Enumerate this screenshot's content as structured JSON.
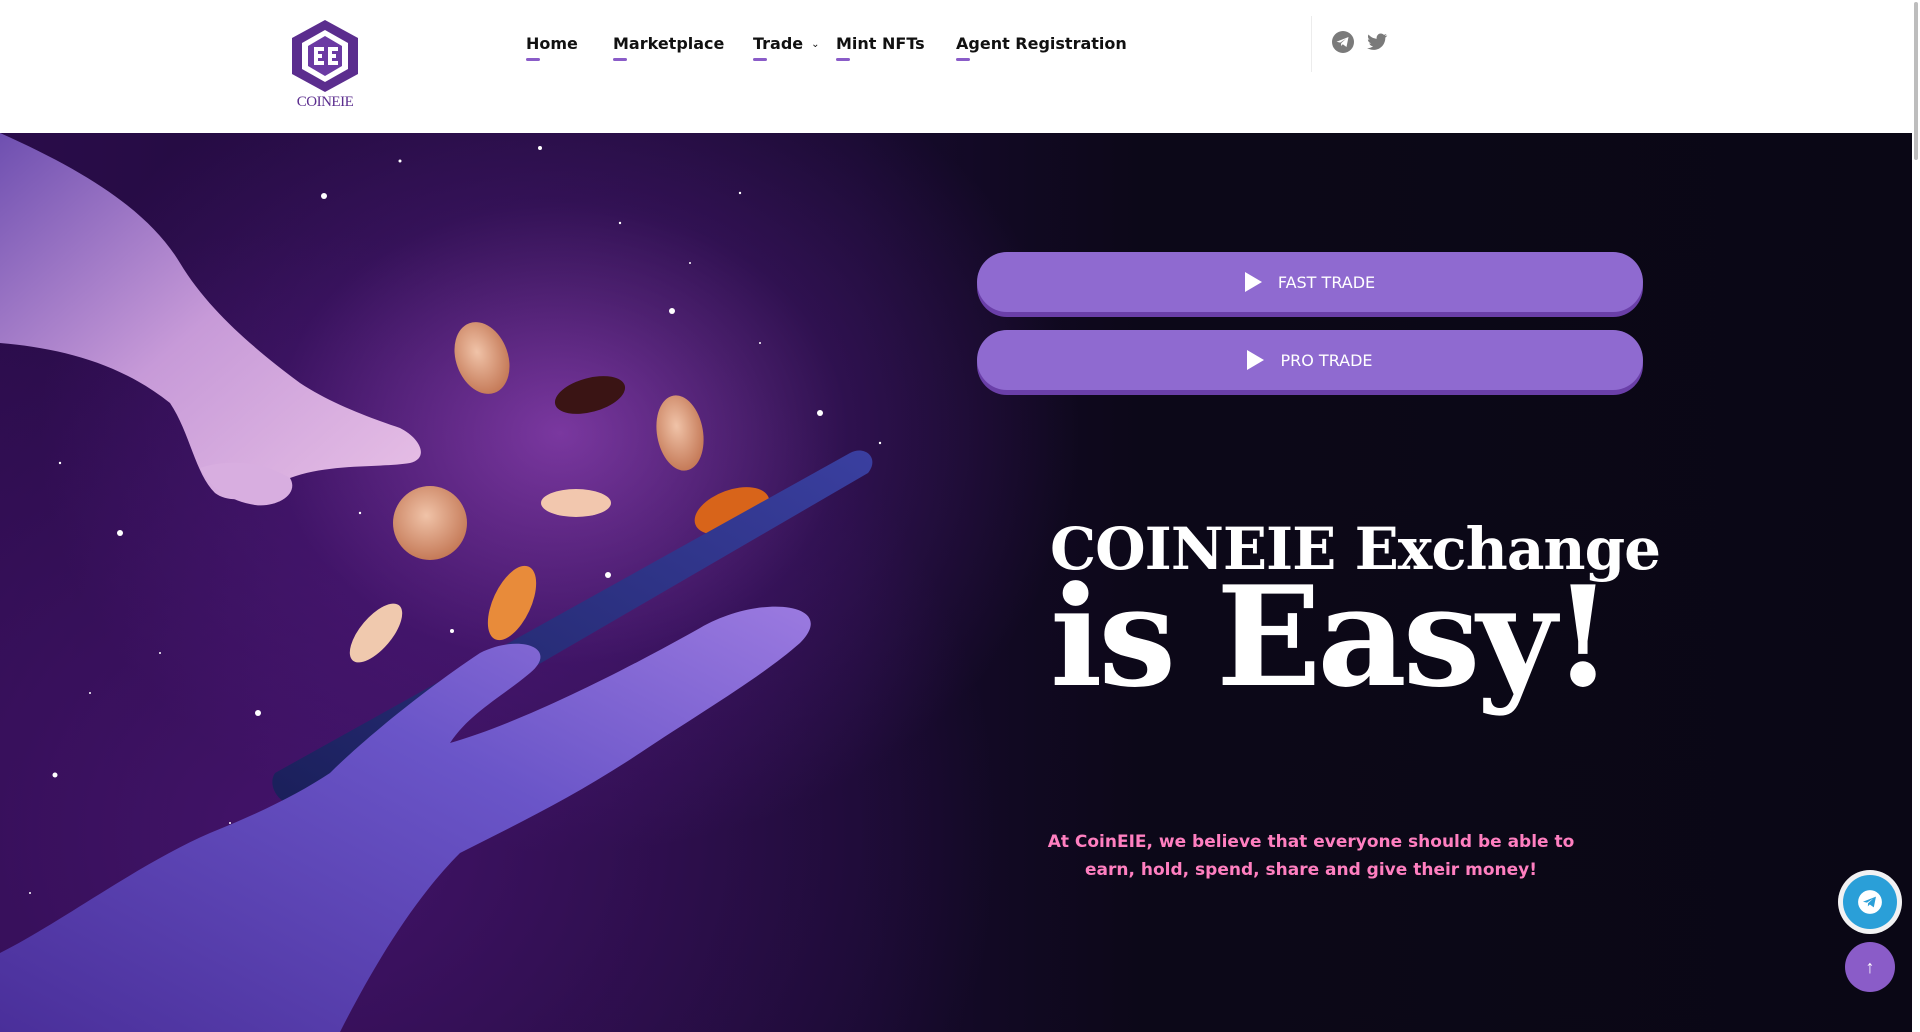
{
  "brand": {
    "name": "COINEIE",
    "primary_color": "#5b2d8e",
    "accent_color": "#8a5cc8"
  },
  "nav": {
    "items": [
      {
        "label": "Home"
      },
      {
        "label": "Marketplace"
      },
      {
        "label": "Trade",
        "has_dropdown": true
      },
      {
        "label": "Mint NFTs"
      },
      {
        "label": "Agent Registration"
      }
    ]
  },
  "social": {
    "icons": [
      "telegram-icon",
      "twitter-icon"
    ]
  },
  "hero": {
    "buttons": [
      {
        "label": "FAST TRADE",
        "icon": "play-icon"
      },
      {
        "label": "PRO TRADE",
        "icon": "play-icon"
      }
    ],
    "headline_line1": "COINEIE Exchange",
    "headline_line2": "is Easy!",
    "tagline": "At CoinEIE, we believe that everyone should be able to earn, hold, spend, share and give their money!",
    "tagline_color": "#ff7fc0",
    "background_color": "#0c0818"
  },
  "floating": {
    "telegram_icon": "telegram-icon",
    "scroll_top_icon": "arrow-up-icon",
    "scroll_top_label": "↑",
    "telegram_color": "#2a9fd8"
  }
}
